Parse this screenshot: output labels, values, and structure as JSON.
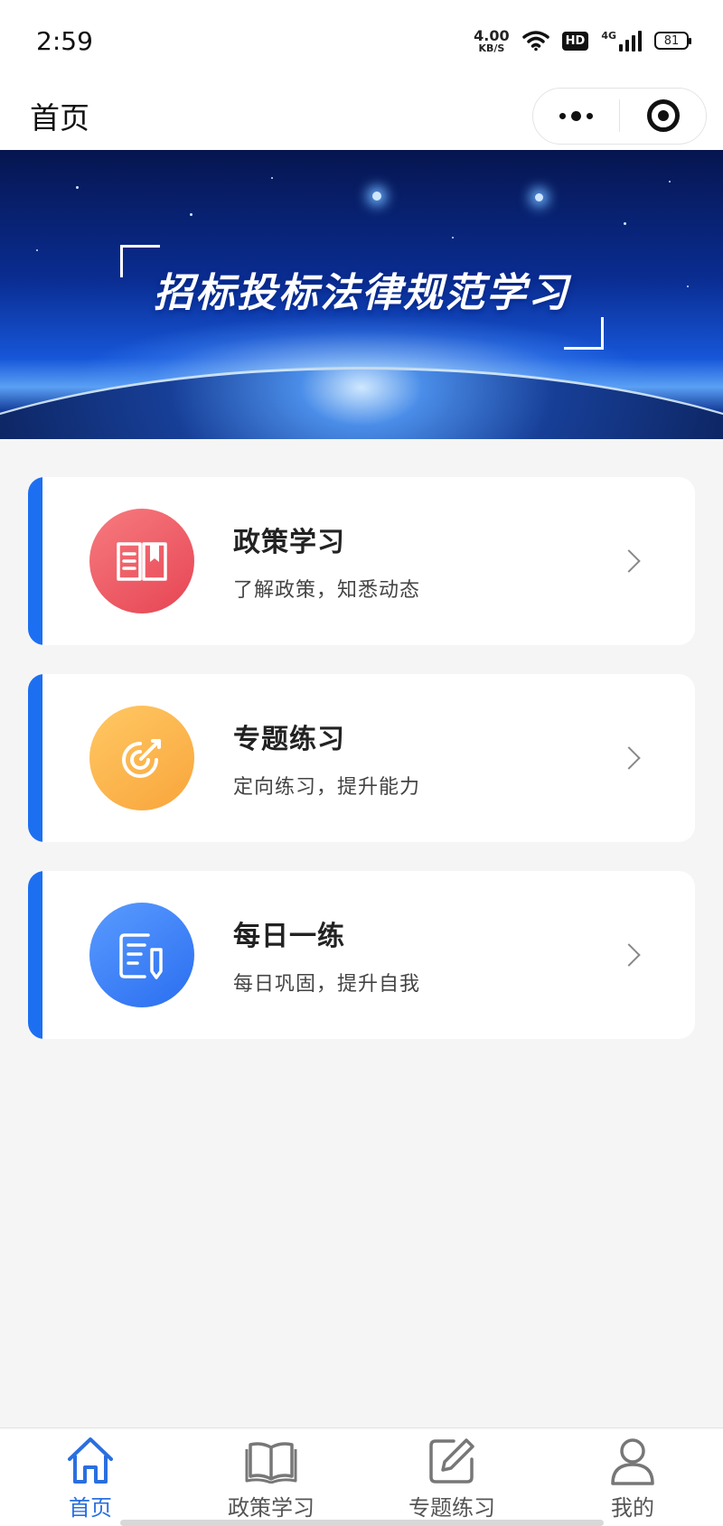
{
  "status_bar": {
    "time": "2:59",
    "net_speed_value": "4.00",
    "net_speed_unit": "KB/S",
    "hd_label": "HD",
    "network_type": "4G",
    "battery": "81"
  },
  "nav_bar": {
    "title": "首页"
  },
  "banner": {
    "title": "招标投标法律规范学习"
  },
  "cards": [
    {
      "title": "政策学习",
      "subtitle": "了解政策，知悉动态",
      "icon": "book-icon",
      "color": "#e64553"
    },
    {
      "title": "专题练习",
      "subtitle": "定向练习，提升能力",
      "icon": "target-icon",
      "color": "#f9a53b"
    },
    {
      "title": "每日一练",
      "subtitle": "每日巩固，提升自我",
      "icon": "note-edit-icon",
      "color": "#2a6ef0"
    }
  ],
  "tabs": [
    {
      "label": "首页",
      "icon": "home-icon",
      "active": true
    },
    {
      "label": "政策学习",
      "icon": "book-icon",
      "active": false
    },
    {
      "label": "专题练习",
      "icon": "edit-icon",
      "active": false
    },
    {
      "label": "我的",
      "icon": "user-icon",
      "active": false
    }
  ],
  "colors": {
    "accent": "#1d6ff2",
    "active_tab": "#2a6fe0"
  }
}
